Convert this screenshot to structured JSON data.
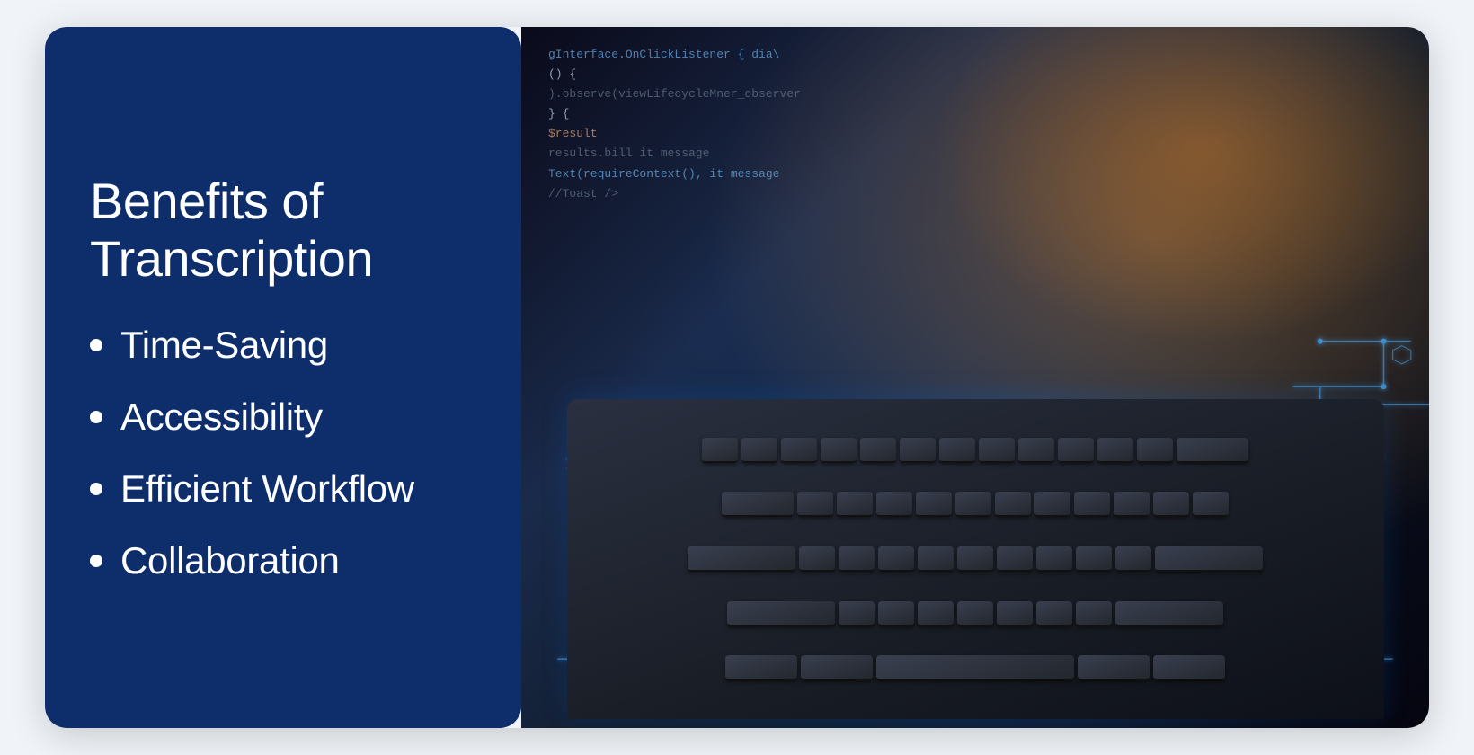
{
  "left_panel": {
    "title_line1": "Benefits of",
    "title_line2": "Transcription",
    "bullet_items": [
      {
        "id": "time-saving",
        "label": "Time-Saving"
      },
      {
        "id": "accessibility",
        "label": "Accessibility"
      },
      {
        "id": "efficient-workflow",
        "label": "Efficient Workflow"
      },
      {
        "id": "collaboration",
        "label": "Collaboration"
      }
    ]
  },
  "right_panel": {
    "alt": "Hands typing on a keyboard with glowing circuit board overlays and code in the background"
  },
  "colors": {
    "left_bg": "#0d2d6b",
    "text": "#ffffff",
    "accent_blue": "#4ab0ff",
    "accent_orange": "#c87828"
  },
  "code_lines": [
    {
      "content": "gInterface.OnClickListener { dia\\",
      "class": "code-blue"
    },
    {
      "content": "() {",
      "class": "code-white"
    },
    {
      "content": "  ).observe(viewLifecycleMner_observer",
      "class": "code-green"
    },
    {
      "content": "  } {",
      "class": "code-white"
    },
    {
      "content": "    $result",
      "class": "code-orange"
    },
    {
      "content": "    results.bill it message",
      "class": "code-gray"
    },
    {
      "content": "    Text(requireContext(), it message",
      "class": "code-blue"
    }
  ]
}
